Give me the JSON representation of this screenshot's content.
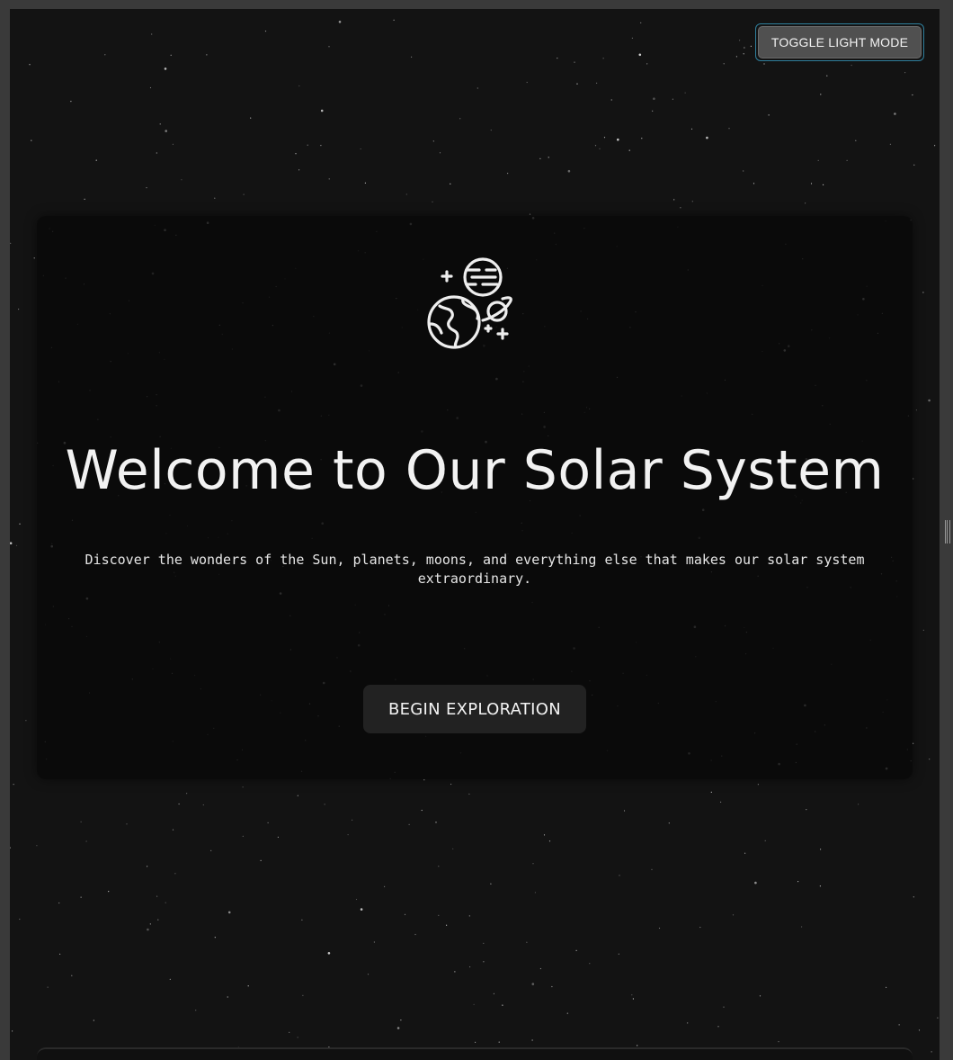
{
  "header": {
    "toggle_label": "TOGGLE LIGHT MODE"
  },
  "hero": {
    "icon": "planets-icon",
    "title": "Welcome to Our Solar System",
    "description": "Discover the wonders of the Sun, planets, moons, and everything else that makes our solar system extraordinary.",
    "cta_label": "BEGIN EXPLORATION"
  },
  "colors": {
    "background": "#131313",
    "card": "#0a0a0a",
    "button": "#222222",
    "toggle": "#505050",
    "focus_ring": "#2f7f9c",
    "text": "#f2f2f2"
  }
}
